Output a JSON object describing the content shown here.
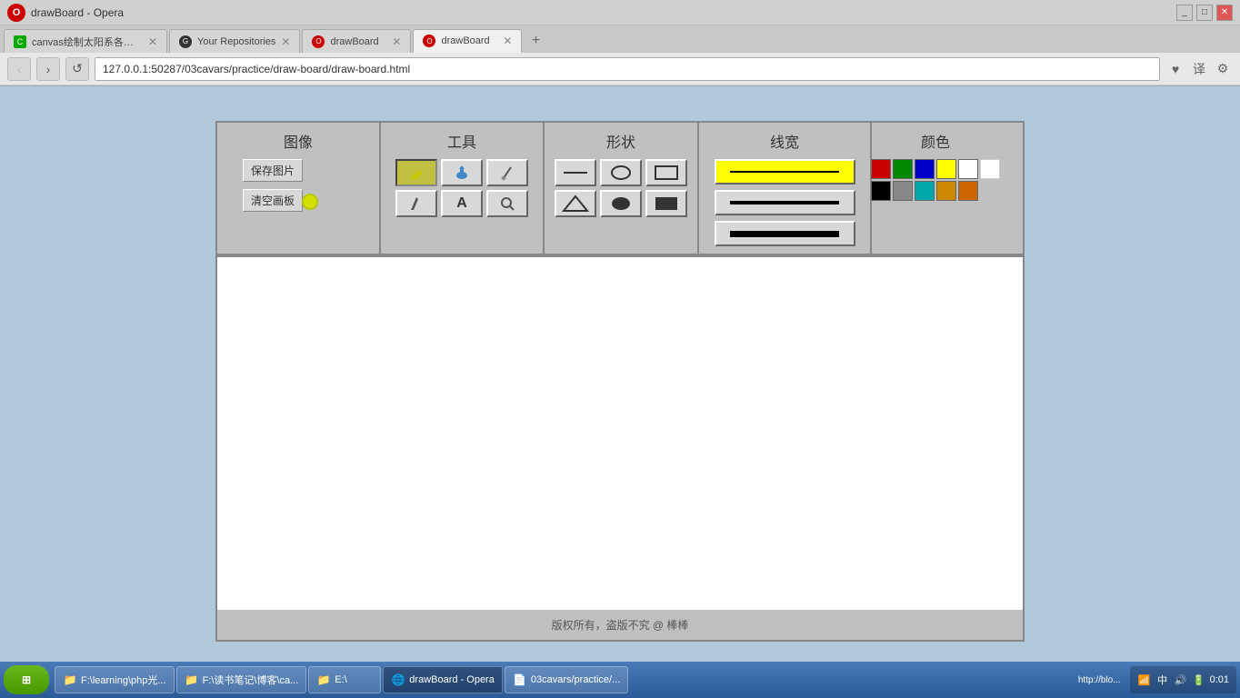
{
  "browser": {
    "title": "drawBoard - Opera",
    "tabs": [
      {
        "id": "tab1",
        "label": "canvas绘制太阳系各行星",
        "active": false,
        "icon": "canvas"
      },
      {
        "id": "tab2",
        "label": "Your Repositories",
        "active": false,
        "icon": "github"
      },
      {
        "id": "tab3",
        "label": "drawBoard",
        "active": false,
        "icon": "opera"
      },
      {
        "id": "tab4",
        "label": "drawBoard",
        "active": true,
        "icon": "opera"
      }
    ],
    "url": "127.0.0.1:50287/03cavars/practice/draw-board/draw-board.html",
    "new_tab_label": "+"
  },
  "toolbar": {
    "image_section": {
      "header": "图像",
      "save_btn": "保存图片",
      "clear_btn": "清空画板"
    },
    "tools_section": {
      "header": "工具",
      "row1": [
        {
          "icon": "✏️",
          "active": true,
          "label": "pencil"
        },
        {
          "icon": "💧",
          "active": false,
          "label": "eraser-fill"
        },
        {
          "icon": "🔧",
          "active": false,
          "label": "settings"
        }
      ],
      "row2": [
        {
          "icon": "✒️",
          "active": false,
          "label": "pen"
        },
        {
          "icon": "A",
          "active": false,
          "label": "text"
        },
        {
          "icon": "🔍",
          "active": false,
          "label": "zoom"
        }
      ]
    },
    "shape_section": {
      "header": "形状",
      "row1": [
        {
          "shape": "line",
          "label": "line-shape"
        },
        {
          "shape": "circle-outline",
          "label": "circle-outline-shape"
        },
        {
          "shape": "rect-outline",
          "label": "rect-outline-shape"
        }
      ],
      "row2": [
        {
          "shape": "triangle-outline",
          "label": "triangle-outline-shape"
        },
        {
          "shape": "circle-fill",
          "label": "circle-fill-shape"
        },
        {
          "shape": "rect-fill",
          "label": "rect-fill-shape"
        }
      ]
    },
    "linewidth_section": {
      "header": "线宽",
      "sizes": [
        {
          "active": true,
          "height": 3,
          "label": "thin-line"
        },
        {
          "active": false,
          "height": 5,
          "label": "medium-line"
        },
        {
          "active": false,
          "height": 8,
          "label": "thick-line"
        }
      ]
    },
    "color_section": {
      "header": "颜色",
      "row1": [
        "#cc0000",
        "#008800",
        "#0000cc",
        "#ffff00",
        "#ffffff"
      ],
      "row2": [
        "#000000",
        "#888888",
        "#00aaaa",
        "#cc8800",
        "#cc6600"
      ],
      "extra": "#ffffff"
    }
  },
  "footer": {
    "copyright": "版权所有，盗版不究 @ 棒棒"
  },
  "taskbar": {
    "start_label": "开始",
    "items": [
      {
        "label": "F:\\learning\\php光..."
      },
      {
        "label": "F:\\读书笔记\\博客\\ca..."
      },
      {
        "label": "E:\\"
      },
      {
        "label": "drawBoard - Opera",
        "active": true
      },
      {
        "label": "03cavars/practice/..."
      }
    ],
    "tray": {
      "time": "0:01",
      "url_hint": "http://blo..."
    }
  }
}
